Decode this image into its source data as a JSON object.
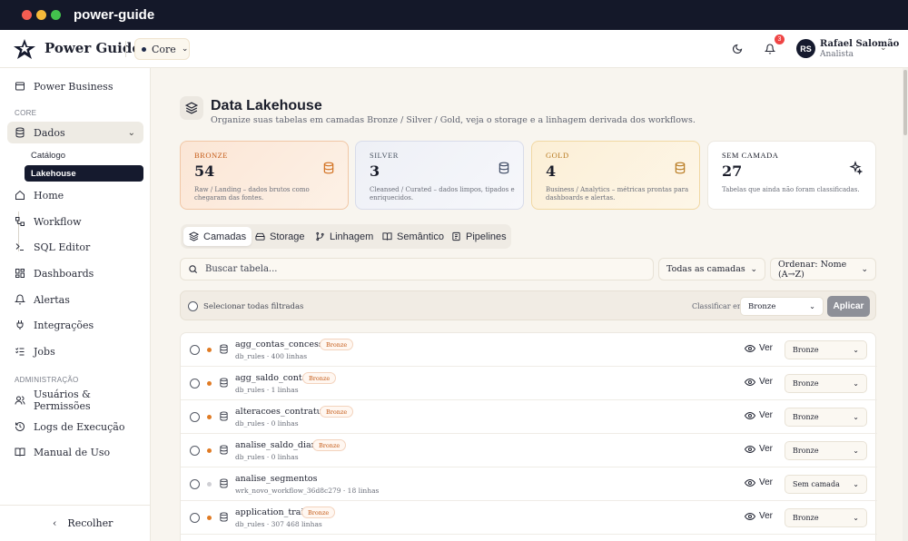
{
  "window": {
    "app_title": "power-guide"
  },
  "appbar": {
    "brand": "Power Guide",
    "workspace": "Core",
    "notifications_count": "3",
    "user": {
      "initials": "RS",
      "name": "Rafael Salomão",
      "role": "Analista"
    }
  },
  "sidebar": {
    "top_item": "Power Business",
    "section_core": "CORE",
    "dados": "Dados",
    "sub_items": [
      "Catálogo",
      "Lakehouse"
    ],
    "items": [
      "Home",
      "Workflow",
      "SQL Editor",
      "Dashboards",
      "Alertas",
      "Integrações",
      "Jobs"
    ],
    "section_admin": "ADMINISTRAÇÃO",
    "admin_items": [
      "Usuários & Permissões",
      "Logs de Execução",
      "Manual de Uso"
    ],
    "collapse": "Recolher"
  },
  "page": {
    "title": "Data Lakehouse",
    "subtitle": "Organize suas tabelas em camadas Bronze / Silver / Gold, veja o storage e a linhagem derivada dos workflows."
  },
  "cards": [
    {
      "label": "BRONZE",
      "count": "54",
      "desc": "Raw / Landing – dados brutos como chegaram das fontes."
    },
    {
      "label": "SILVER",
      "count": "3",
      "desc": "Cleansed / Curated – dados limpos, tipados e enriquecidos."
    },
    {
      "label": "GOLD",
      "count": "4",
      "desc": "Business / Analytics – métricas prontas para dashboards e alertas."
    },
    {
      "label": "SEM CAMADA",
      "count": "27",
      "desc": "Tabelas que ainda não foram classificadas."
    }
  ],
  "tabs": [
    "Camadas",
    "Storage",
    "Linhagem",
    "Semântico",
    "Pipelines"
  ],
  "filters": {
    "search_placeholder": "Buscar tabela...",
    "layer_filter": "Todas as camadas",
    "order": "Ordenar: Nome (A→Z)"
  },
  "bulk": {
    "select_all": "Selecionar todas filtradas",
    "classify_label": "Classificar em:",
    "classify_value": "Bronze",
    "apply": "Aplicar"
  },
  "rows": [
    {
      "name": "agg_contas_concessao",
      "tag": "Bronze",
      "meta": "db_rules · 400 linhas",
      "layer": "Bronze",
      "status_color": "#e07b24"
    },
    {
      "name": "agg_saldo_conta2",
      "tag": "Bronze",
      "meta": "db_rules · 1 linhas",
      "layer": "Bronze",
      "status_color": "#e07b24"
    },
    {
      "name": "alteracoes_contratuais",
      "tag": "Bronze",
      "meta": "db_rules · 0 linhas",
      "layer": "Bronze",
      "status_color": "#e07b24"
    },
    {
      "name": "analise_saldo_diario",
      "tag": "Bronze",
      "meta": "db_rules · 0 linhas",
      "layer": "Bronze",
      "status_color": "#e07b24"
    },
    {
      "name": "analise_segmentos",
      "tag": "",
      "meta": "wrk_novo_workflow_36d8c279 · 18 linhas",
      "layer": "Sem camada",
      "status_color": "#cfcfd4"
    },
    {
      "name": "application_train",
      "tag": "Bronze",
      "meta": "db_rules · 307 468 linhas",
      "layer": "Bronze",
      "status_color": "#e07b24"
    }
  ],
  "ver_label": "Ver"
}
